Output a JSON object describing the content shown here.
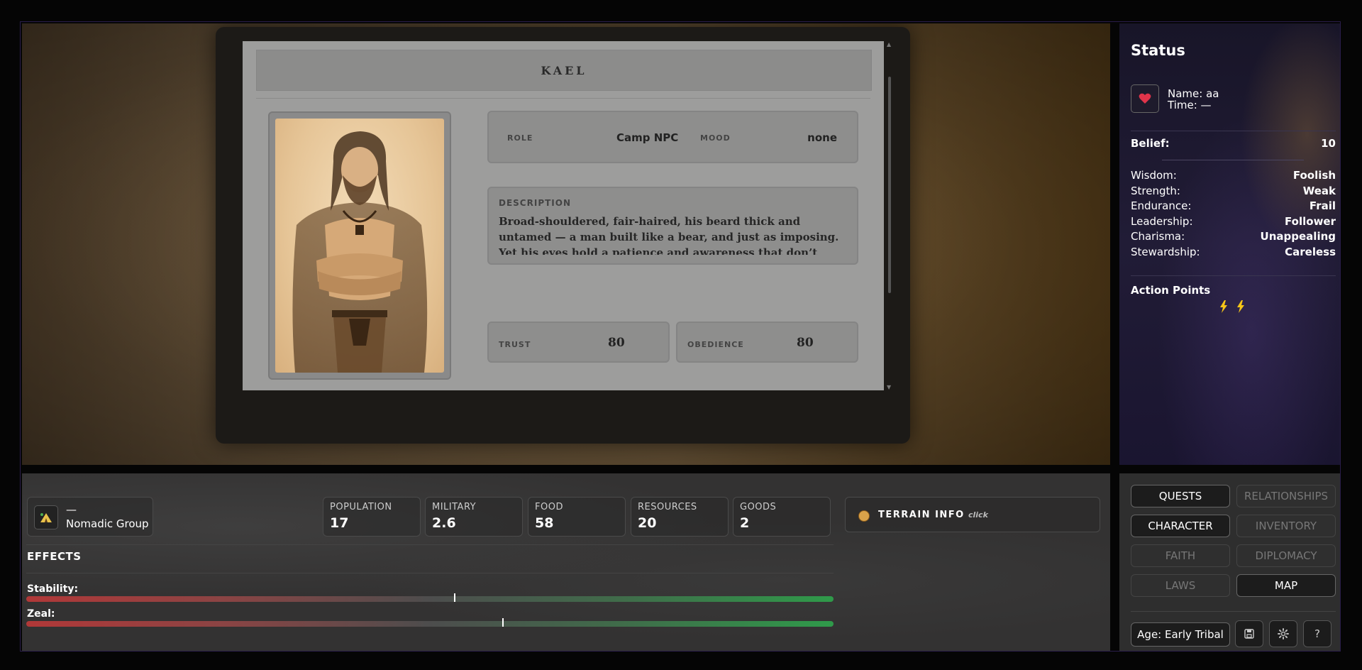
{
  "character": {
    "name": "KAEL",
    "role_label": "ROLE",
    "role_value": "Camp NPC",
    "mood_label": "MOOD",
    "mood_value": "none",
    "description_label": "DESCRIPTION",
    "description": "Broad-shouldered, fair-haired, his beard thick and untamed — a man built like a bear, and just as imposing. Yet his eyes hold a patience and awareness that don’t quite fit his age.",
    "trust_label": "TRUST",
    "trust_value": "80",
    "obedience_label": "OBEDIENCE",
    "obedience_value": "80"
  },
  "status": {
    "title": "Status",
    "name_line": "Name: aa",
    "time_line": "Time: —",
    "belief_label": "Belief:",
    "belief_value": "10",
    "attributes": [
      {
        "label": "Wisdom:",
        "value": "Foolish"
      },
      {
        "label": "Strength:",
        "value": "Weak"
      },
      {
        "label": "Endurance:",
        "value": "Frail"
      },
      {
        "label": "Leadership:",
        "value": "Follower"
      },
      {
        "label": "Charisma:",
        "value": "Unappealing"
      },
      {
        "label": "Stewardship:",
        "value": "Careless"
      }
    ],
    "action_points_label": "Action Points",
    "action_points": 2,
    "heart_color": "#e0344a",
    "bolt_color": "#f5c518"
  },
  "group": {
    "name": "—",
    "type": "Nomadic Group"
  },
  "stats": [
    {
      "label": "POPULATION",
      "value": "17"
    },
    {
      "label": "MILITARY",
      "value": "2.6"
    },
    {
      "label": "FOOD",
      "value": "58"
    },
    {
      "label": "RESOURCES",
      "value": "20"
    },
    {
      "label": "GOODS",
      "value": "2"
    }
  ],
  "terrain": {
    "label": "TERRAIN INFO",
    "hint": "click"
  },
  "effects": {
    "title": "EFFECTS",
    "stability_label": "Stability:",
    "stability_pct": 53,
    "zeal_label": "Zeal:",
    "zeal_pct": 59
  },
  "tabs": [
    {
      "label": "QUESTS",
      "active": true
    },
    {
      "label": "RELATIONSHIPS",
      "active": false
    },
    {
      "label": "CHARACTER",
      "active": true
    },
    {
      "label": "INVENTORY",
      "active": false
    },
    {
      "label": "FAITH",
      "active": false
    },
    {
      "label": "DIPLOMACY",
      "active": false
    },
    {
      "label": "LAWS",
      "active": false
    },
    {
      "label": "MAP",
      "active": true
    }
  ],
  "age": "Age: Early Tribal",
  "help_label": "?"
}
